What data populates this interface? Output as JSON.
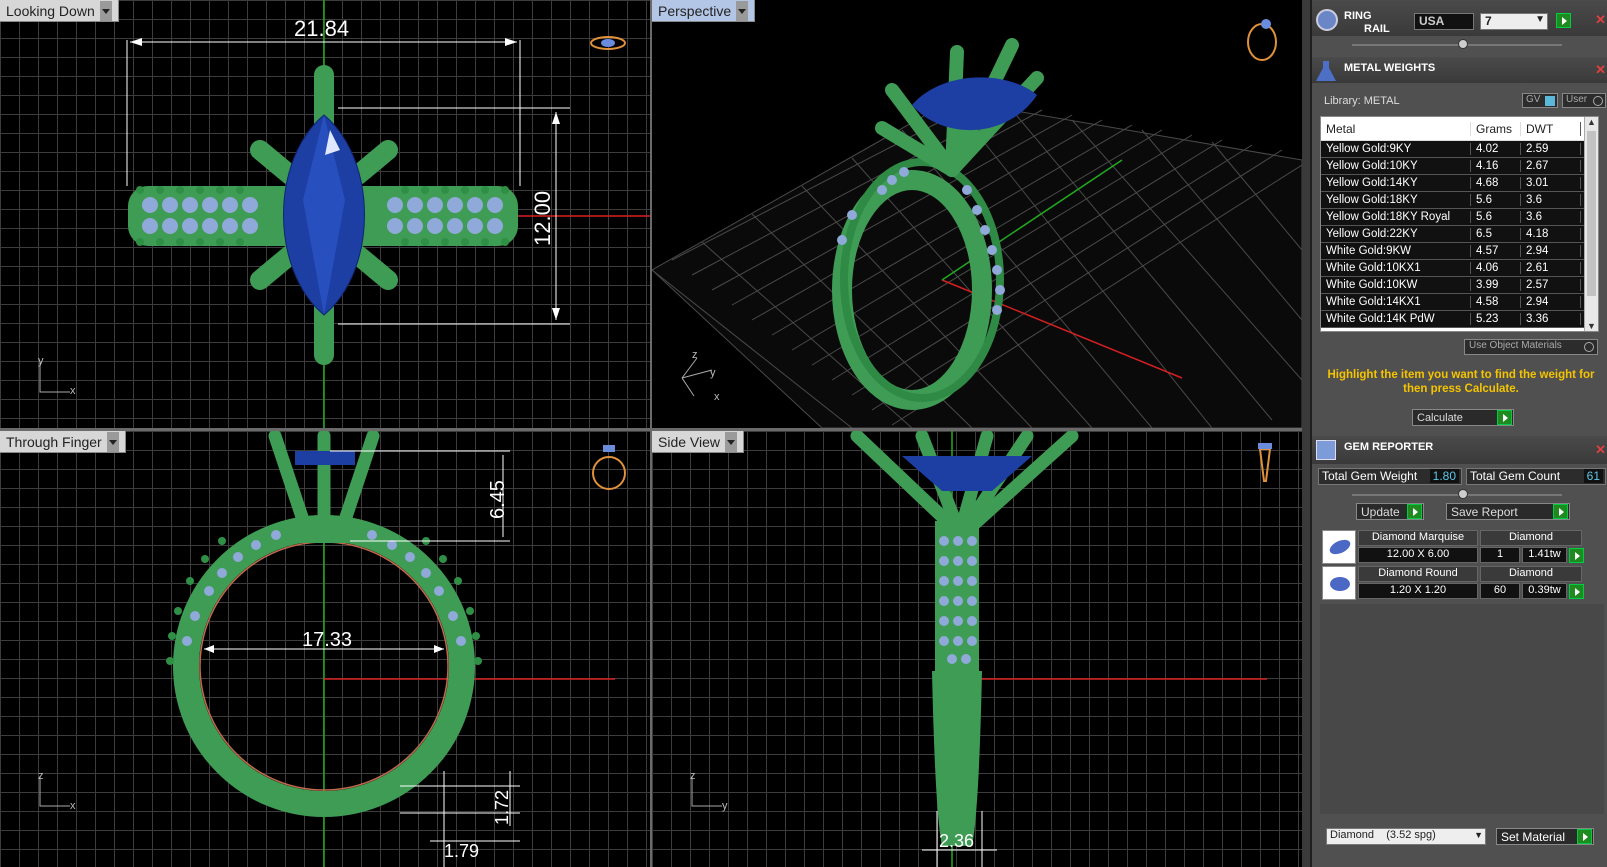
{
  "viewports": {
    "top_left": {
      "label": "Looking Down",
      "dims": [
        "21.84",
        "12.00"
      ],
      "axes": [
        "y",
        "x"
      ]
    },
    "top_right": {
      "label": "Perspective",
      "axes": [
        "z",
        "y",
        "x"
      ]
    },
    "bottom_left": {
      "label": "Through Finger",
      "dims": [
        "6.45",
        "17.33",
        "1.72",
        "1.79"
      ],
      "axes": [
        "z",
        "x"
      ]
    },
    "bottom_right": {
      "label": "Side View",
      "dims": [
        "2.36"
      ],
      "axes": [
        "z",
        "y"
      ]
    }
  },
  "ring_rail": {
    "title_1": "RING",
    "title_2": "RAIL",
    "country": "USA",
    "size": "7"
  },
  "metal_weights": {
    "title": "METAL WEIGHTS",
    "library_label": "Library: METAL",
    "gv_label": "GV",
    "user_label": "User",
    "columns": [
      "Metal",
      "Grams",
      "DWT"
    ],
    "rows": [
      {
        "metal": "Yellow Gold:9KY",
        "grams": "4.02",
        "dwt": "2.59"
      },
      {
        "metal": "Yellow Gold:10KY",
        "grams": "4.16",
        "dwt": "2.67"
      },
      {
        "metal": "Yellow Gold:14KY",
        "grams": "4.68",
        "dwt": "3.01"
      },
      {
        "metal": "Yellow Gold:18KY",
        "grams": "5.6",
        "dwt": "3.6"
      },
      {
        "metal": "Yellow Gold:18KY Royal",
        "grams": "5.6",
        "dwt": "3.6"
      },
      {
        "metal": "Yellow Gold:22KY",
        "grams": "6.5",
        "dwt": "4.18"
      },
      {
        "metal": "White Gold:9KW",
        "grams": "4.57",
        "dwt": "2.94"
      },
      {
        "metal": "White Gold:10KX1",
        "grams": "4.06",
        "dwt": "2.61"
      },
      {
        "metal": "White Gold:10KW",
        "grams": "3.99",
        "dwt": "2.57"
      },
      {
        "metal": "White Gold:14KX1",
        "grams": "4.58",
        "dwt": "2.94"
      },
      {
        "metal": "White Gold:14K PdW",
        "grams": "5.23",
        "dwt": "3.36"
      }
    ],
    "use_object_materials": "Use Object Materials",
    "hint": "Highlight the item you want to find the weight for then press Calculate.",
    "calculate_label": "Calculate"
  },
  "gem_reporter": {
    "title": "GEM REPORTER",
    "total_weight_label": "Total Gem Weight",
    "total_weight_value": "1.80",
    "total_count_label": "Total Gem Count",
    "total_count_value": "61",
    "update_label": "Update",
    "save_report_label": "Save Report",
    "gems": [
      {
        "name": "Diamond Marquise",
        "material": "Diamond",
        "size": "12.00 X 6.00",
        "count": "1",
        "weight": "1.41tw"
      },
      {
        "name": "Diamond Round",
        "material": "Diamond",
        "size": "1.20 X 1.20",
        "count": "60",
        "weight": "0.39tw"
      }
    ],
    "material_select": "Diamond    (3.52 spg)",
    "set_material_label": "Set Material"
  },
  "colors": {
    "metal_green": "#3f9c55",
    "gem_blue": "#1d3fa3",
    "pave_blue": "#8fa9d8",
    "accent_yellow": "#f5c400",
    "axis_red": "#d62020",
    "axis_green": "#22aa22"
  }
}
